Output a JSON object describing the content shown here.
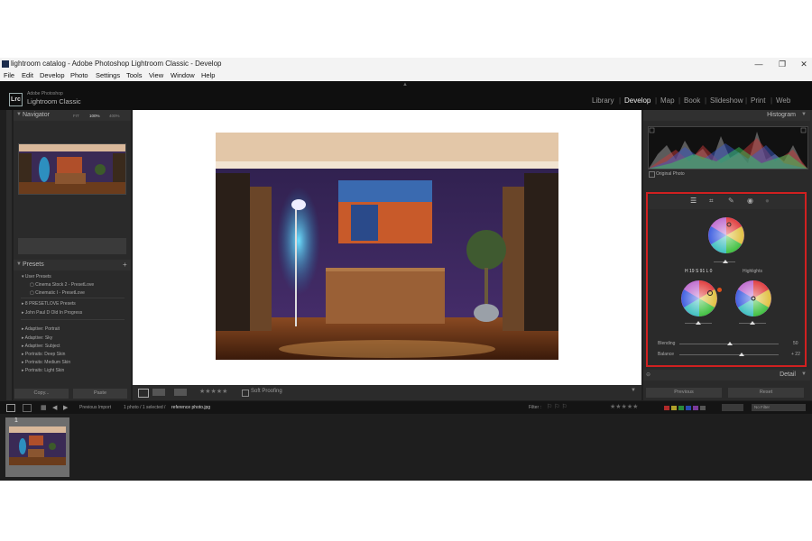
{
  "window": {
    "title": "lightroom catalog - Adobe Photoshop Lightroom Classic - Develop"
  },
  "menu": [
    "File",
    "Edit",
    "Develop",
    "Photo",
    "Settings",
    "Tools",
    "View",
    "Window",
    "Help"
  ],
  "brand": {
    "line1": "Adobe Photoshop",
    "line2": "Lightroom Classic",
    "logo": "Lrc"
  },
  "modules": [
    "Library",
    "Develop",
    "Map",
    "Book",
    "Slideshow",
    "Print",
    "Web"
  ],
  "active_module": "Develop",
  "navigator": {
    "title": "Navigator",
    "zoom_fit": "FIT",
    "zoom_fill": "FILL",
    "zoom_100": "100%",
    "zoom_other": "400%"
  },
  "presets": {
    "title": "Presets",
    "groups": [
      {
        "label": "User Presets",
        "children": [
          "Cinema Stock 2 - PresetLove",
          "Cinematic I - PresetLove"
        ]
      },
      {
        "label": "8 PRESETLOVE Presets"
      },
      {
        "label": "John Paul D Old In Progress"
      },
      {
        "label": "Adaptive: Portrait"
      },
      {
        "label": "Adaptive: Sky"
      },
      {
        "label": "Adaptive: Subject"
      },
      {
        "label": "Portraits: Deep Skin"
      },
      {
        "label": "Portraits: Medium Skin"
      },
      {
        "label": "Portraits: Light Skin"
      }
    ]
  },
  "left_buttons": {
    "copy": "Copy...",
    "paste": "Paste"
  },
  "toolbar": {
    "soft_proofing": "Soft Proofing",
    "stars": "★★★★★"
  },
  "histogram": {
    "title": "Histogram",
    "original_photo": "Original Photo"
  },
  "color_grading": {
    "readout": "H 19 S 91 L 0",
    "highlights_label": "Highlights",
    "blending_label": "Blending",
    "blending_value": "50",
    "balance_label": "Balance",
    "balance_value": "+ 22"
  },
  "detail": {
    "title": "Detail"
  },
  "right_buttons": {
    "previous": "Previous",
    "reset": "Reset"
  },
  "filmbar": {
    "previous_import": "Previous Import",
    "path_prefix": "1 photo / 1 selected /",
    "filename": "reference photo.jpg",
    "filter_label": "Filter :",
    "no_filter": "No Filter"
  },
  "filmstrip": {
    "index": "1"
  },
  "colors": {
    "accent_red": "#d02020",
    "background": "#1f1f1f"
  }
}
